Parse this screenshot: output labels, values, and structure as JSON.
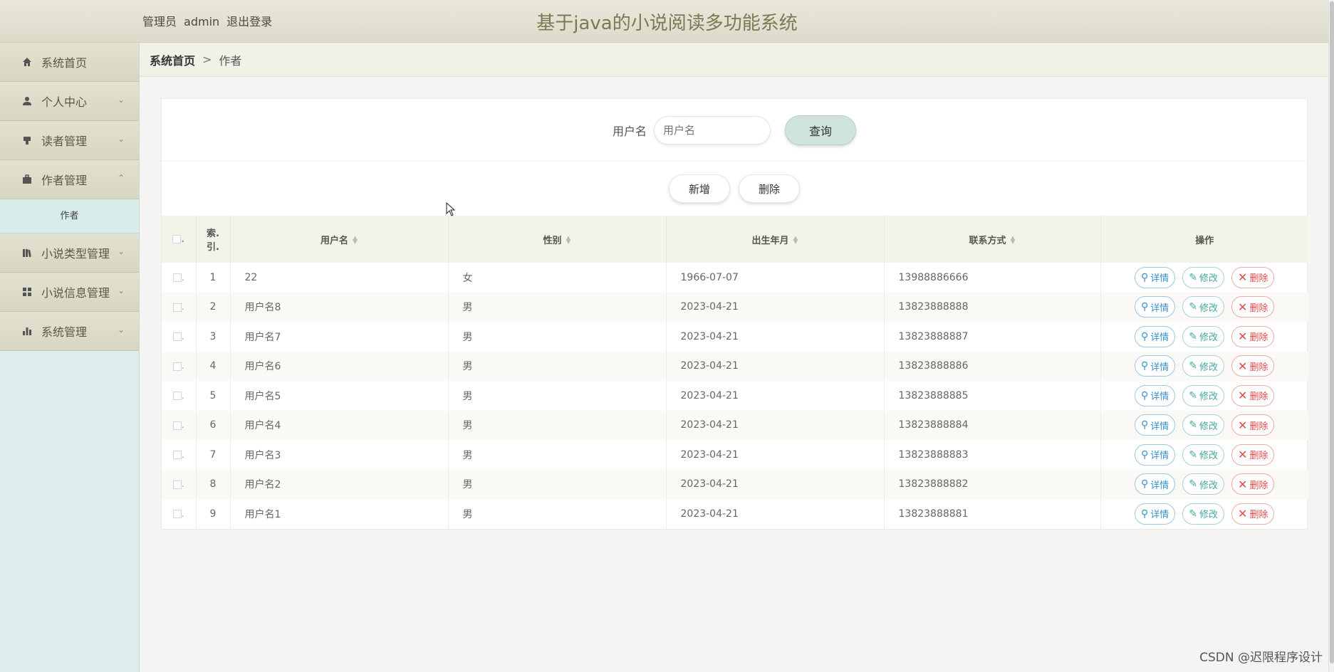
{
  "header": {
    "role_label": "管理员",
    "username": "admin",
    "logout_label": "退出登录",
    "app_title": "基于java的小说阅读多功能系统"
  },
  "sidebar": {
    "items": [
      {
        "label": "系统首页",
        "icon": "home-icon"
      },
      {
        "label": "个人中心",
        "icon": "user-icon"
      },
      {
        "label": "读者管理",
        "icon": "reader-icon"
      },
      {
        "label": "作者管理",
        "icon": "briefcase-icon"
      },
      {
        "label": "小说类型管理",
        "icon": "book-icon"
      },
      {
        "label": "小说信息管理",
        "icon": "grid-icon"
      },
      {
        "label": "系统管理",
        "icon": "bar-chart-icon"
      }
    ],
    "submenu": {
      "label": "作者"
    }
  },
  "breadcrumb": {
    "home": "系统首页",
    "separator": ">",
    "current": "作者"
  },
  "search": {
    "label": "用户名",
    "placeholder": "用户名",
    "button": "查询"
  },
  "actions": {
    "add": "新增",
    "delete": "删除"
  },
  "table": {
    "columns": {
      "index": "索引",
      "index_line1": "索.",
      "index_line2": "引.",
      "username": "用户名",
      "gender": "性别",
      "birth": "出生年月",
      "contact": "联系方式",
      "ops": "操作"
    },
    "op_labels": {
      "detail": "详情",
      "edit": "修改",
      "delete": "删除"
    },
    "rows": [
      {
        "idx": "1",
        "username": "22",
        "gender": "女",
        "birth": "1966-07-07",
        "contact": "13988886666"
      },
      {
        "idx": "2",
        "username": "用户名8",
        "gender": "男",
        "birth": "2023-04-21",
        "contact": "13823888888"
      },
      {
        "idx": "3",
        "username": "用户名7",
        "gender": "男",
        "birth": "2023-04-21",
        "contact": "13823888887"
      },
      {
        "idx": "4",
        "username": "用户名6",
        "gender": "男",
        "birth": "2023-04-21",
        "contact": "13823888886"
      },
      {
        "idx": "5",
        "username": "用户名5",
        "gender": "男",
        "birth": "2023-04-21",
        "contact": "13823888885"
      },
      {
        "idx": "6",
        "username": "用户名4",
        "gender": "男",
        "birth": "2023-04-21",
        "contact": "13823888884"
      },
      {
        "idx": "7",
        "username": "用户名3",
        "gender": "男",
        "birth": "2023-04-21",
        "contact": "13823888883"
      },
      {
        "idx": "8",
        "username": "用户名2",
        "gender": "男",
        "birth": "2023-04-21",
        "contact": "13823888882"
      },
      {
        "idx": "9",
        "username": "用户名1",
        "gender": "男",
        "birth": "2023-04-21",
        "contact": "13823888881"
      }
    ]
  },
  "watermark": "CSDN @迟限程序设计",
  "colors": {
    "header_bg": "#e2e1cf",
    "sidebar_bg": "#deeceb",
    "title": "#7a7a55",
    "detail": "#3a90c8",
    "edit": "#45a8a0",
    "delete": "#e04a4a"
  }
}
